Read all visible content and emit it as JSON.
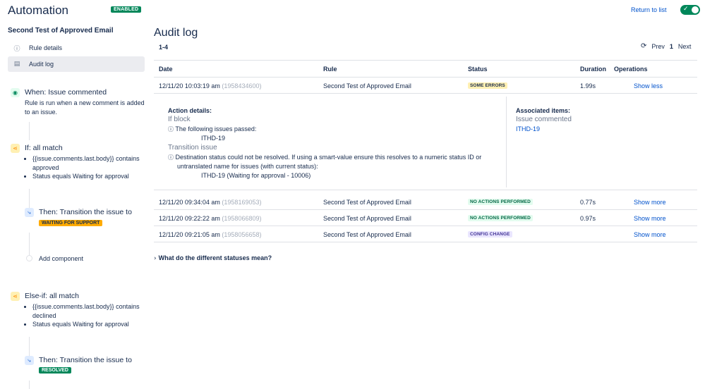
{
  "header": {
    "app_title": "Automation",
    "enabled_badge": "ENABLED",
    "return_link": "Return to list",
    "toggle_on": true
  },
  "sidebar": {
    "rule_name": "Second Test of Approved Email",
    "nav": [
      {
        "label": "Rule details",
        "icon": "info-icon"
      },
      {
        "label": "Audit log",
        "icon": "document-icon",
        "active": true
      }
    ],
    "components": {
      "trigger": {
        "title": "When: Issue commented",
        "desc": "Rule is run when a new comment is added to an issue."
      },
      "if_block": {
        "title": "If: all match",
        "items": [
          "{{issue.comments.last.body}} contains approved",
          "Status equals Waiting for approval"
        ]
      },
      "then1": {
        "title": "Then: Transition the issue to",
        "lozenge": "WAITING FOR SUPPORT"
      },
      "add_component": "Add component",
      "else_if": {
        "title": "Else-if: all match",
        "items": [
          "{{issue.comments.last.body}} contains declined",
          "Status equals Waiting for approval"
        ]
      },
      "then2": {
        "title": "Then: Transition the issue to",
        "lozenge": "RESOLVED"
      }
    }
  },
  "main": {
    "title": "Audit log",
    "count": "1-4",
    "pager": {
      "prev": "Prev",
      "current": "1",
      "next": "Next"
    },
    "columns": [
      "Date",
      "Rule",
      "Status",
      "Duration",
      "Operations"
    ],
    "rows": [
      {
        "date": "12/11/20 10:03:19 am",
        "id": "(1958434600)",
        "rule": "Second Test of Approved Email",
        "status": "SOME ERRORS",
        "duration": "1.99s",
        "op": "Show less"
      },
      {
        "date": "12/11/20 09:34:04 am",
        "id": "(1958169053)",
        "rule": "Second Test of Approved Email",
        "status": "NO ACTIONS PERFORMED",
        "duration": "0.77s",
        "op": "Show more"
      },
      {
        "date": "12/11/20 09:22:22 am",
        "id": "(1958066809)",
        "rule": "Second Test of Approved Email",
        "status": "NO ACTIONS PERFORMED",
        "duration": "0.97s",
        "op": "Show more"
      },
      {
        "date": "12/11/20 09:21:05 am",
        "id": "(1958056658)",
        "rule": "Second Test of Approved Email",
        "status": "CONFIG CHANGE",
        "duration": "",
        "op": "Show more"
      }
    ],
    "details": {
      "action_heading": "Action details:",
      "if_block": "If block",
      "passed_msg": "The following issues passed:",
      "passed_issue": "ITHD-19",
      "transition": "Transition issue",
      "error_line1": "Destination status could not be resolved. If using a smart-value ensure this resolves to a numeric status ID or",
      "error_line2": "untranslated name for issues (with current status):",
      "error_issue": "ITHD-19 (Waiting for approval - 10006)",
      "assoc_heading": "Associated items:",
      "assoc_event": "Issue commented",
      "assoc_issue": "ITHD-19"
    },
    "statuses_link": "What do the different statuses mean?"
  }
}
